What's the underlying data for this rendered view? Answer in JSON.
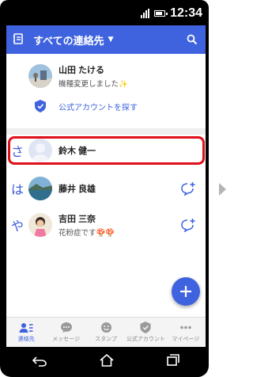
{
  "statusbar": {
    "time": "12:34"
  },
  "appbar": {
    "title": "すべての連絡先",
    "title_icon": "contacts-book-icon",
    "menu_icon": "caret-down-icon",
    "search_icon": "search-icon"
  },
  "contacts": [
    {
      "index": "",
      "name": "山田 たける",
      "status": "機種変更しました",
      "status_emoji": "sparkle"
    },
    {
      "index": "",
      "name": "公式アカウントを探す",
      "status": "",
      "icon": "shield-icon"
    },
    {
      "index": "さ",
      "name": "鈴木 健一",
      "status": ""
    },
    {
      "index": "は",
      "name": "藤井 良雄",
      "status": ""
    },
    {
      "index": "や",
      "name": "吉田 三奈",
      "status": "花粉症です",
      "status_emoji": "mushroom"
    }
  ],
  "tabs": [
    {
      "label": "連絡先",
      "icon": "contacts-icon",
      "active": true
    },
    {
      "label": "メッセージ",
      "icon": "message-icon",
      "active": false
    },
    {
      "label": "スタンプ",
      "icon": "sticker-icon",
      "active": false
    },
    {
      "label": "公式アカウント",
      "icon": "official-account-icon",
      "active": false
    },
    {
      "label": "マイページ",
      "icon": "more-icon",
      "active": false
    }
  ],
  "colors": {
    "accent": "#3f63df",
    "highlight": "#e0101b"
  }
}
